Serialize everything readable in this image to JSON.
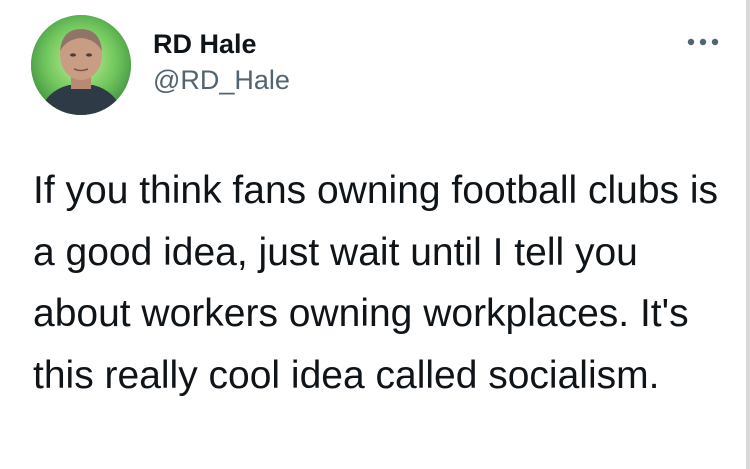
{
  "tweet": {
    "author": {
      "display_name": "RD Hale",
      "handle": "@RD_Hale",
      "avatar": "profile-photo"
    },
    "more_icon": "more-horizontal-icon",
    "text": "If you think fans owning football clubs is a good idea, just wait until I tell you about workers owning workplaces. It's this really cool idea called socialism."
  },
  "colors": {
    "text": "#0f1419",
    "secondary_text": "#536471",
    "background": "#ffffff"
  }
}
